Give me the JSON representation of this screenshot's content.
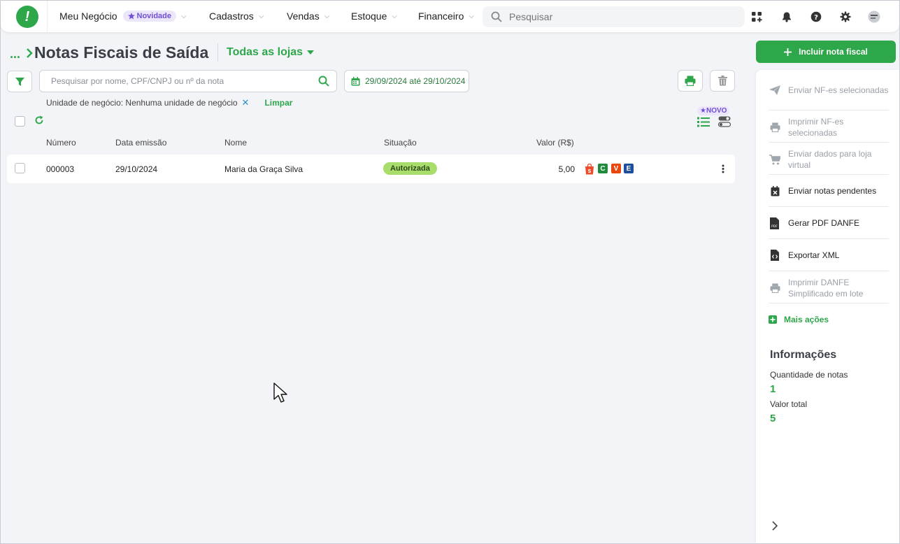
{
  "nav": {
    "items": [
      {
        "label": "Meu Negócio",
        "badge": "Novidade"
      },
      {
        "label": "Cadastros"
      },
      {
        "label": "Vendas"
      },
      {
        "label": "Estoque"
      },
      {
        "label": "Financeiro"
      }
    ],
    "search_placeholder": "Pesquisar"
  },
  "header": {
    "breadcrumb": "...",
    "title": "Notas Fiscais de Saída",
    "store_filter": "Todas as lojas"
  },
  "filters": {
    "search_placeholder": "Pesquisar por nome, CPF/CNPJ ou nº da nota",
    "date_range": "29/09/2024 até 29/10/2024",
    "chip": "Unidade de negócio: Nenhuma unidade de negócio",
    "clear_label": "Limpar",
    "novo_badge": "NOVO"
  },
  "table": {
    "columns": [
      "Número",
      "Data emissão",
      "Nome",
      "Situação",
      "Valor (R$)"
    ],
    "rows": [
      {
        "numero": "000003",
        "data": "29/10/2024",
        "nome": "Maria da Graça Silva",
        "situacao": "Autorizada",
        "valor": "5,00",
        "tags": [
          "C",
          "V",
          "E"
        ]
      }
    ]
  },
  "sidebar": {
    "add_button": "Incluir nota fiscal",
    "actions": [
      {
        "label": "Enviar NF-es selecionadas",
        "icon": "send-icon",
        "enabled": false
      },
      {
        "label": "Imprimir NF-es selecionadas",
        "icon": "printer-icon",
        "enabled": false
      },
      {
        "label": "Enviar dados para loja virtual",
        "icon": "cart-icon",
        "enabled": false
      },
      {
        "label": "Enviar notas pendentes",
        "icon": "calendar-x-icon",
        "enabled": true
      },
      {
        "label": "Gerar PDF DANFE",
        "icon": "pdf-icon",
        "enabled": true
      },
      {
        "label": "Exportar XML",
        "icon": "xml-file-icon",
        "enabled": true
      },
      {
        "label": "Imprimir DANFE Simplificado em lote",
        "icon": "printer-icon",
        "enabled": false
      }
    ],
    "more_actions": "Mais ações",
    "info": {
      "title": "Informações",
      "qty_label": "Quantidade de notas",
      "qty_value": "1",
      "total_label": "Valor total",
      "total_value": "5"
    }
  },
  "colors": {
    "primary": "#2ea64a",
    "status_authorized": "#a8dc6b",
    "badge_purple": "#6f4fd6"
  }
}
